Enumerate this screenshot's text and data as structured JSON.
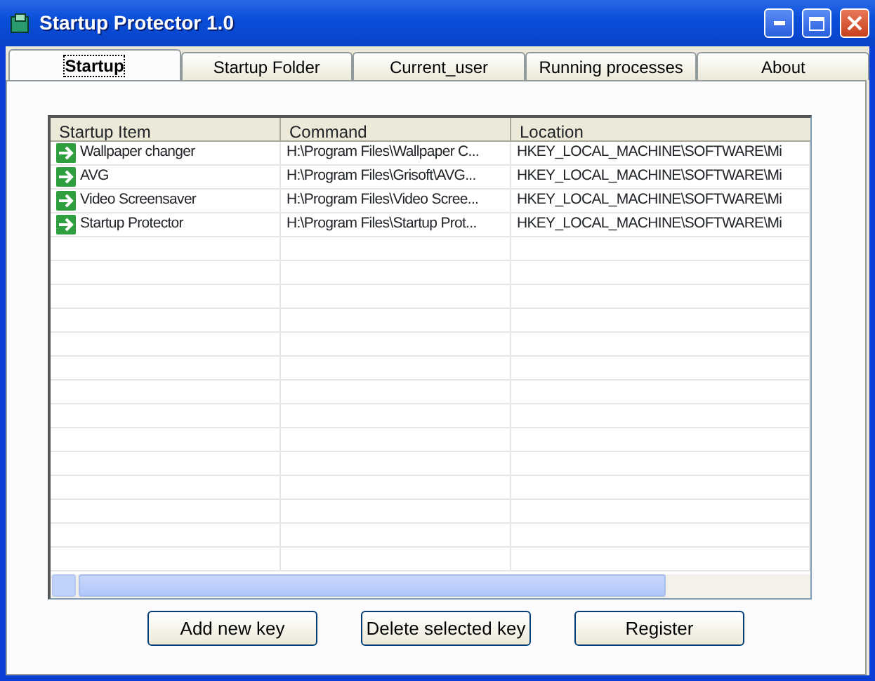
{
  "window": {
    "title": "Startup Protector 1.0"
  },
  "tabs": [
    {
      "label": "Startup",
      "selected": true
    },
    {
      "label": "Startup Folder",
      "selected": false
    },
    {
      "label": "Current_user",
      "selected": false
    },
    {
      "label": "Running processes",
      "selected": false
    },
    {
      "label": "About",
      "selected": false
    }
  ],
  "table": {
    "columns": [
      "Startup Item",
      "Command",
      "Location"
    ],
    "rows": [
      [
        "Wallpaper changer",
        "H:\\Program Files\\Wallpaper C...",
        "HKEY_LOCAL_MACHINE\\SOFTWARE\\Mi"
      ],
      [
        "AVG",
        "H:\\Program Files\\Grisoft\\AVG...",
        "HKEY_LOCAL_MACHINE\\SOFTWARE\\Mi"
      ],
      [
        "Video Screensaver",
        "H:\\Program Files\\Video Scree...",
        "HKEY_LOCAL_MACHINE\\SOFTWARE\\Mi"
      ],
      [
        "Startup Protector",
        "H:\\Program Files\\Startup Prot...",
        "HKEY_LOCAL_MACHINE\\SOFTWARE\\Mi"
      ]
    ]
  },
  "buttons": [
    "Add new key",
    "Delete selected key",
    "Register"
  ]
}
